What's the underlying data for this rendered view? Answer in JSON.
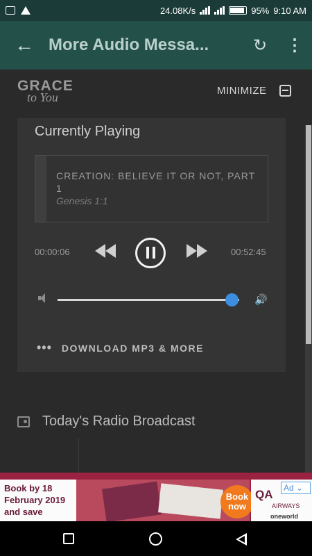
{
  "status_bar": {
    "speed": "24.08K/s",
    "battery": "95%",
    "time": "9:10 AM"
  },
  "app_bar": {
    "title": "More Audio Messa..."
  },
  "brand": {
    "logo_line1": "GRACE",
    "logo_line2": "to You",
    "minimize_label": "MINIMIZE"
  },
  "player": {
    "heading": "Currently Playing",
    "track_title": "CREATION: BELIEVE IT OR NOT, PART 1",
    "track_reference": "Genesis 1:1",
    "elapsed": "00:00:06",
    "duration": "00:52:45",
    "volume_level": 0.96,
    "state": "playing",
    "download_label": "DOWNLOAD MP3 & MORE"
  },
  "radio": {
    "label": "Today's Radio Broadcast"
  },
  "ad": {
    "text": "Book by 18 February 2019 and save",
    "cta": "Book now",
    "brand": "QA",
    "brand_sub": "AIRWAYS",
    "alliance": "oneworld",
    "badge": "Ad"
  },
  "colors": {
    "status_bar": "#1b3b38",
    "app_bar": "#24504a",
    "background": "#2a2a2a",
    "card": "#343434",
    "slider_thumb": "#3c8fe0"
  },
  "icons": {
    "back": "arrow-left-icon",
    "refresh": "refresh-icon",
    "more": "more-vertical-icon",
    "minimize": "minimize-icon",
    "rewind": "rewind-icon",
    "pause": "pause-icon",
    "fast_forward": "fast-forward-icon",
    "volume_low": "volume-low-icon",
    "volume_high": "volume-high-icon",
    "radio": "radio-icon"
  }
}
